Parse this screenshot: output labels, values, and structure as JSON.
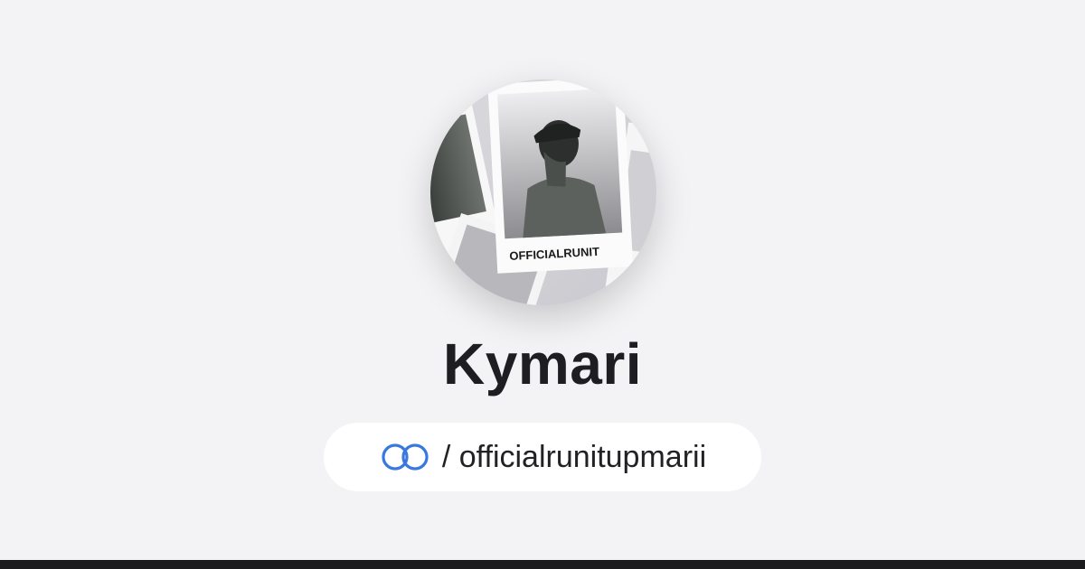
{
  "profile": {
    "name": "Kymari",
    "avatar_caption": "OFFICIALRUNIT",
    "avatar_description": "profile-photo"
  },
  "handle": {
    "icon": "linked-rings-icon",
    "prefix": "/",
    "username": "officialrunitupmarii",
    "display": "/ officialrunitupmarii"
  },
  "colors": {
    "background": "#f3f3f5",
    "name_text": "#1e1e22",
    "pill_background": "#ffffff",
    "icon_blue": "#3a78e0",
    "bottom_bar": "#1b1b1d"
  }
}
